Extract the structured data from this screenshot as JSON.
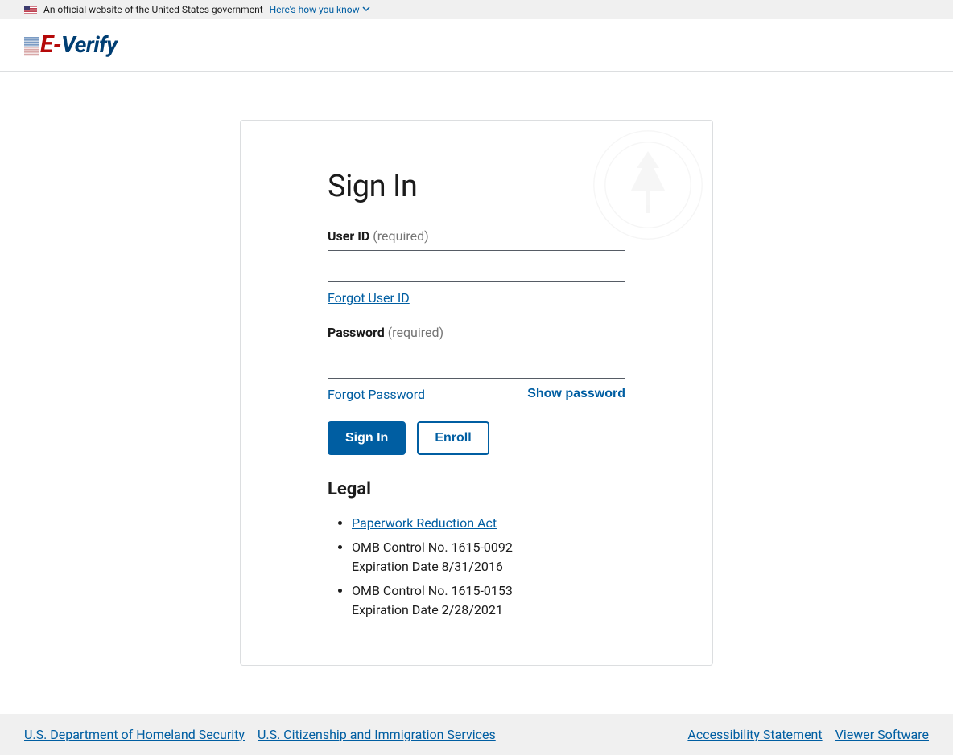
{
  "gov_banner": {
    "text": "An official website of the United States government",
    "link_text": "Here's how you know"
  },
  "logo": {
    "e": "E",
    "dash": "-",
    "verify": "Verify"
  },
  "signin": {
    "heading": "Sign In",
    "user_id": {
      "label": "User ID",
      "required": "(required)",
      "value": "",
      "forgot": "Forgot User ID"
    },
    "password": {
      "label": "Password",
      "required": "(required)",
      "value": "",
      "forgot": "Forgot Password",
      "show": "Show password"
    },
    "signin_button": "Sign In",
    "enroll_button": "Enroll"
  },
  "legal": {
    "heading": "Legal",
    "pra_link": "Paperwork Reduction Act",
    "omb1_line1": "OMB Control No. 1615-0092",
    "omb1_line2": "Expiration Date 8/31/2016",
    "omb2_line1": "OMB Control No. 1615-0153",
    "omb2_line2": "Expiration Date 2/28/2021"
  },
  "footer": {
    "dhs": "U.S. Department of Homeland Security",
    "uscis": "U.S. Citizenship and Immigration Services",
    "accessibility": "Accessibility Statement",
    "viewer": "Viewer Software"
  }
}
